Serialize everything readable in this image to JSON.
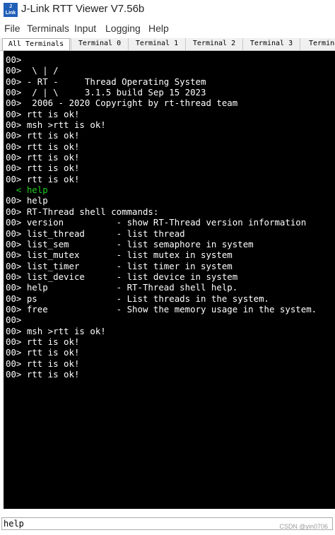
{
  "window": {
    "title": "J-Link RTT Viewer V7.56b",
    "icon_text_line1": "J",
    "icon_text_line2": "Link"
  },
  "menu": [
    "File",
    "Terminals",
    "Input",
    "Logging",
    "Help"
  ],
  "tabs": [
    {
      "label": "All Terminals",
      "active": true
    },
    {
      "label": "Terminal 0",
      "active": false
    },
    {
      "label": "Terminal 1",
      "active": false
    },
    {
      "label": "Terminal 2",
      "active": false
    },
    {
      "label": "Terminal 3",
      "active": false
    },
    {
      "label": "Termina",
      "active": false
    }
  ],
  "terminal": {
    "background": "#000000",
    "text_color": "#ffffff",
    "echo_color": "#22cc22",
    "lines": [
      {
        "text": "00>",
        "echo": false
      },
      {
        "text": "00>  \\ | /",
        "echo": false
      },
      {
        "text": "00> - RT -     Thread Operating System",
        "echo": false
      },
      {
        "text": "00>  / | \\     3.1.5 build Sep 15 2023",
        "echo": false
      },
      {
        "text": "00>  2006 - 2020 Copyright by rt-thread team",
        "echo": false
      },
      {
        "text": "00> rtt is ok!",
        "echo": false
      },
      {
        "text": "00> msh >rtt is ok!",
        "echo": false
      },
      {
        "text": "00> rtt is ok!",
        "echo": false
      },
      {
        "text": "00> rtt is ok!",
        "echo": false
      },
      {
        "text": "00> rtt is ok!",
        "echo": false
      },
      {
        "text": "00> rtt is ok!",
        "echo": false
      },
      {
        "text": "00> rtt is ok!",
        "echo": false
      },
      {
        "text": "  < help",
        "echo": true
      },
      {
        "text": "00> help",
        "echo": false
      },
      {
        "text": "00> RT-Thread shell commands:",
        "echo": false
      },
      {
        "text": "00> version          - show RT-Thread version information",
        "echo": false
      },
      {
        "text": "00> list_thread      - list thread",
        "echo": false
      },
      {
        "text": "00> list_sem         - list semaphore in system",
        "echo": false
      },
      {
        "text": "00> list_mutex       - list mutex in system",
        "echo": false
      },
      {
        "text": "00> list_timer       - list timer in system",
        "echo": false
      },
      {
        "text": "00> list_device      - list device in system",
        "echo": false
      },
      {
        "text": "00> help             - RT-Thread shell help.",
        "echo": false
      },
      {
        "text": "00> ps               - List threads in the system.",
        "echo": false
      },
      {
        "text": "00> free             - Show the memory usage in the system.",
        "echo": false
      },
      {
        "text": "00>",
        "echo": false
      },
      {
        "text": "00> msh >rtt is ok!",
        "echo": false
      },
      {
        "text": "00> rtt is ok!",
        "echo": false
      },
      {
        "text": "00> rtt is ok!",
        "echo": false
      },
      {
        "text": "00> rtt is ok!",
        "echo": false
      },
      {
        "text": "00> rtt is ok!",
        "echo": false
      }
    ]
  },
  "input": {
    "value": "help"
  },
  "watermark": "CSDN @yin0706"
}
